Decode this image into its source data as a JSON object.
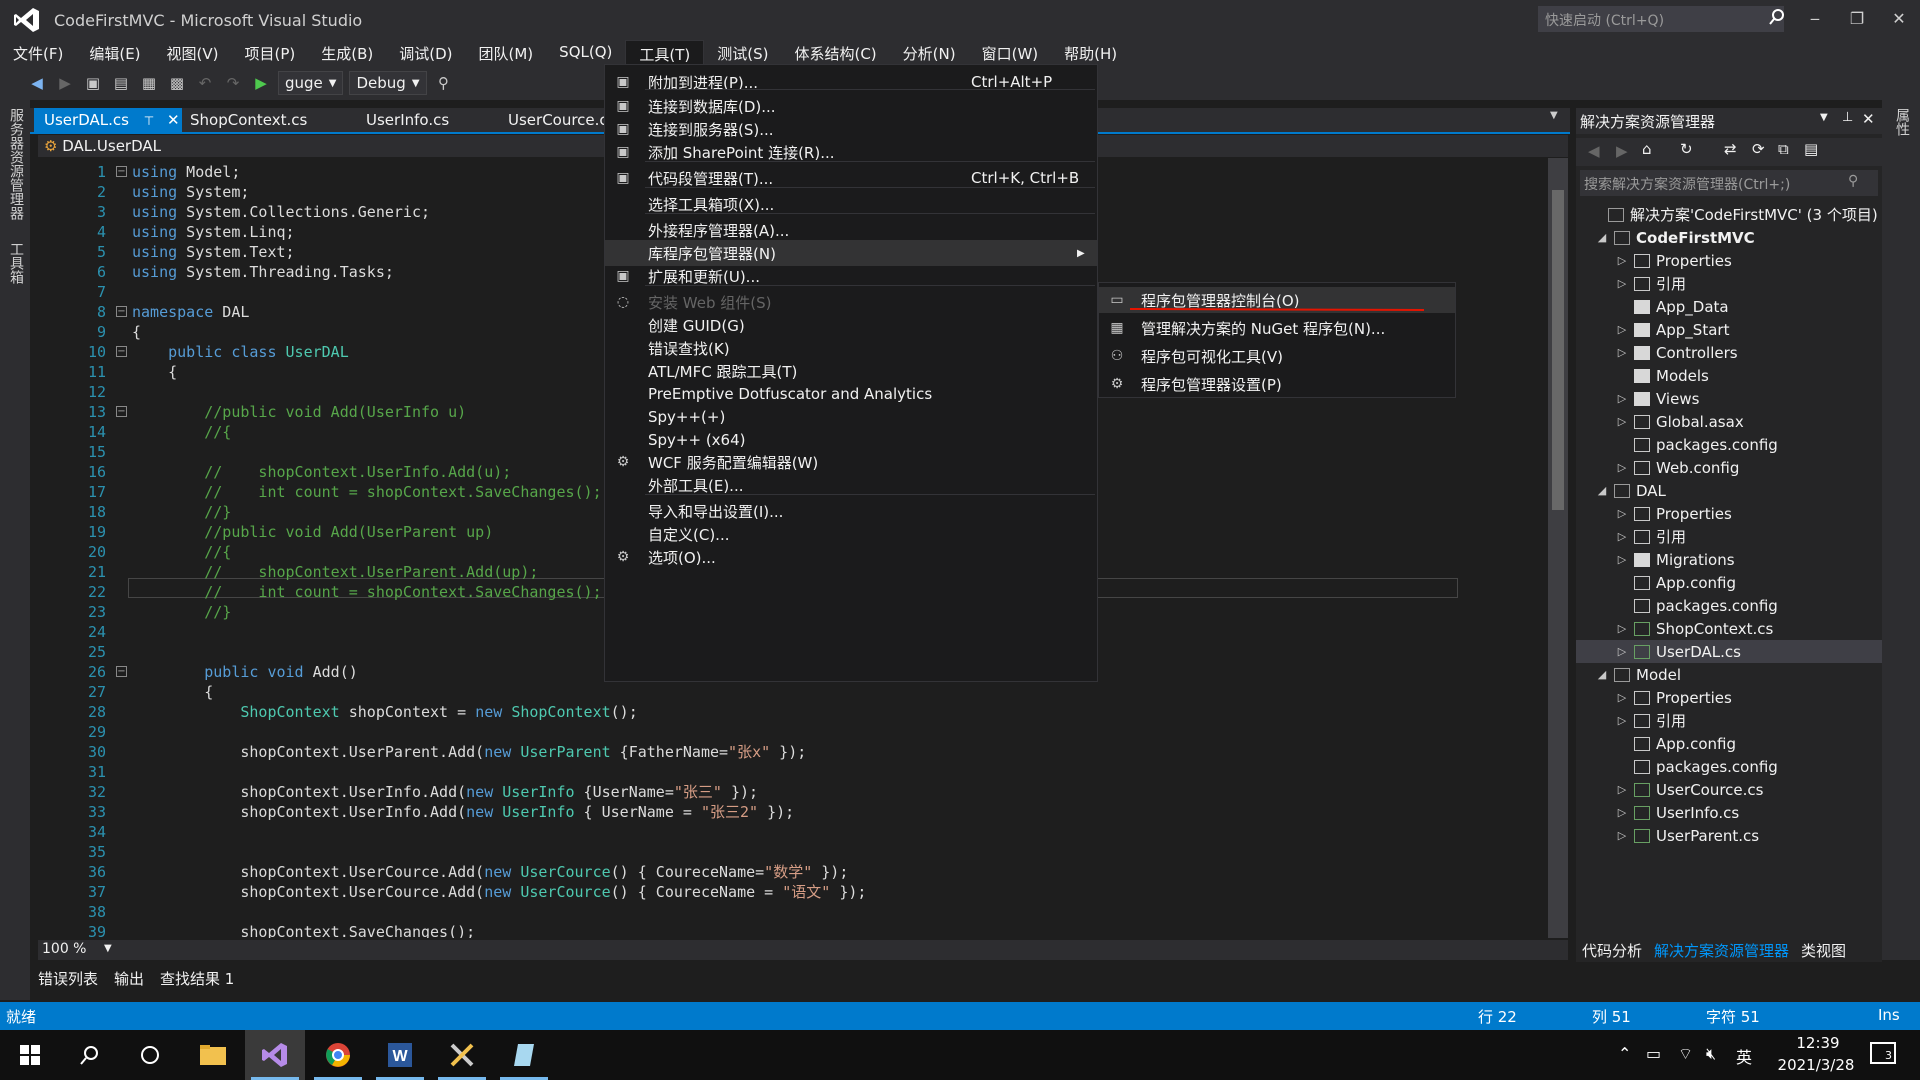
{
  "window": {
    "title": "CodeFirstMVC - Microsoft Visual Studio",
    "quick_launch": "快速启动 (Ctrl+Q)"
  },
  "menubar": [
    "文件(F)",
    "编辑(E)",
    "视图(V)",
    "项目(P)",
    "生成(B)",
    "调试(D)",
    "团队(M)",
    "SQL(Q)",
    "工具(T)",
    "测试(S)",
    "体系结构(C)",
    "分析(N)",
    "窗口(W)",
    "帮助(H)"
  ],
  "toolbar": {
    "start_label": "guge",
    "config": "Debug"
  },
  "left_strip": {
    "server_explorer": "服务器资源管理器",
    "toolbox": "工具箱"
  },
  "tabs": [
    "UserDAL.cs",
    "ShopContext.cs",
    "UserInfo.cs",
    "UserCource.cs"
  ],
  "navbar": {
    "scope": "DAL.UserDAL"
  },
  "code_lines": [
    {
      "n": "1",
      "t": "using Model;"
    },
    {
      "n": "2",
      "t": "using System;"
    },
    {
      "n": "3",
      "t": "using System.Collections.Generic;"
    },
    {
      "n": "4",
      "t": "using System.Linq;"
    },
    {
      "n": "5",
      "t": "using System.Text;"
    },
    {
      "n": "6",
      "t": "using System.Threading.Tasks;"
    },
    {
      "n": "7",
      "t": ""
    },
    {
      "n": "8",
      "t": "namespace DAL"
    },
    {
      "n": "9",
      "t": "{"
    },
    {
      "n": "10",
      "t": "    public class UserDAL"
    },
    {
      "n": "11",
      "t": "    {"
    },
    {
      "n": "12",
      "t": ""
    },
    {
      "n": "13",
      "t": "        //public void Add(UserInfo u)"
    },
    {
      "n": "14",
      "t": "        //{"
    },
    {
      "n": "15",
      "t": ""
    },
    {
      "n": "16",
      "t": "        //    shopContext.UserInfo.Add(u);"
    },
    {
      "n": "17",
      "t": "        //    int count = shopContext.SaveChanges();"
    },
    {
      "n": "18",
      "t": "        //}"
    },
    {
      "n": "19",
      "t": "        //public void Add(UserParent up)"
    },
    {
      "n": "20",
      "t": "        //{"
    },
    {
      "n": "21",
      "t": "        //    shopContext.UserParent.Add(up);"
    },
    {
      "n": "22",
      "t": "        //    int count = shopContext.SaveChanges();"
    },
    {
      "n": "23",
      "t": "        //}"
    },
    {
      "n": "24",
      "t": ""
    },
    {
      "n": "25",
      "t": ""
    },
    {
      "n": "26",
      "t": "        public void Add()"
    },
    {
      "n": "27",
      "t": "        {"
    },
    {
      "n": "28",
      "t": "            ShopContext shopContext = new ShopContext();"
    },
    {
      "n": "29",
      "t": ""
    },
    {
      "n": "30",
      "t": "            shopContext.UserParent.Add(new UserParent {FatherName=\"张x\" });"
    },
    {
      "n": "31",
      "t": ""
    },
    {
      "n": "32",
      "t": "            shopContext.UserInfo.Add(new UserInfo {UserName=\"张三\" });"
    },
    {
      "n": "33",
      "t": "            shopContext.UserInfo.Add(new UserInfo { UserName = \"张三2\" });"
    },
    {
      "n": "34",
      "t": ""
    },
    {
      "n": "35",
      "t": ""
    },
    {
      "n": "36",
      "t": "            shopContext.UserCource.Add(new UserCource() { CoureceName=\"数学\" });"
    },
    {
      "n": "37",
      "t": "            shopContext.UserCource.Add(new UserCource() { CoureceName = \"语文\" });"
    },
    {
      "n": "38",
      "t": ""
    },
    {
      "n": "39",
      "t": "            shopContext.SaveChanges();"
    }
  ],
  "zoom": "100 %",
  "bottom_tabs": [
    "错误列表",
    "输出",
    "查找结果 1"
  ],
  "tools_menu": [
    {
      "label": "附加到进程(P)...",
      "shortcut": "Ctrl+Alt+P",
      "icon": "attach-icon"
    },
    {
      "label": "连接到数据库(D)...",
      "shortcut": "",
      "icon": "database-icon"
    },
    {
      "label": "连接到服务器(S)...",
      "shortcut": "",
      "icon": "server-icon"
    },
    {
      "label": "添加 SharePoint 连接(R)...",
      "shortcut": "",
      "icon": "sharepoint-icon"
    },
    {
      "label": "代码段管理器(T)...",
      "shortcut": "Ctrl+K, Ctrl+B",
      "icon": "snippet-icon"
    },
    {
      "label": "选择工具箱项(X)...",
      "shortcut": "",
      "icon": ""
    },
    {
      "label": "外接程序管理器(A)...",
      "shortcut": "",
      "icon": ""
    },
    {
      "label": "库程序包管理器(N)",
      "shortcut": "",
      "icon": ""
    },
    {
      "label": "扩展和更新(U)...",
      "shortcut": "",
      "icon": "extensions-icon"
    },
    {
      "label": "安装 Web 组件(S)",
      "shortcut": "",
      "icon": "web-icon"
    },
    {
      "label": "创建 GUID(G)",
      "shortcut": "",
      "icon": ""
    },
    {
      "label": "错误查找(K)",
      "shortcut": "",
      "icon": ""
    },
    {
      "label": "ATL/MFC 跟踪工具(T)",
      "shortcut": "",
      "icon": ""
    },
    {
      "label": "PreEmptive Dotfuscator and Analytics",
      "shortcut": "",
      "icon": ""
    },
    {
      "label": "Spy++(+)",
      "shortcut": "",
      "icon": ""
    },
    {
      "label": "Spy++ (x64)",
      "shortcut": "",
      "icon": ""
    },
    {
      "label": "WCF 服务配置编辑器(W)",
      "shortcut": "",
      "icon": "wcf-icon"
    },
    {
      "label": "外部工具(E)...",
      "shortcut": "",
      "icon": ""
    },
    {
      "label": "导入和导出设置(I)...",
      "shortcut": "",
      "icon": ""
    },
    {
      "label": "自定义(C)...",
      "shortcut": "",
      "icon": ""
    },
    {
      "label": "选项(O)...",
      "shortcut": "",
      "icon": "gear-icon"
    }
  ],
  "package_submenu": [
    {
      "label": "程序包管理器控制台(O)",
      "icon": "console-icon"
    },
    {
      "label": "管理解决方案的 NuGet 程序包(N)...",
      "icon": "nuget-icon"
    },
    {
      "label": "程序包可视化工具(V)",
      "icon": "visualizer-icon"
    },
    {
      "label": "程序包管理器设置(P)",
      "icon": "gear-icon"
    }
  ],
  "solution_explorer": {
    "title": "解决方案资源管理器",
    "search_placeholder": "搜索解决方案资源管理器(Ctrl+;)",
    "nodes": [
      {
        "label": "解决方案'CodeFirstMVC' (3 个项目)",
        "level": 0,
        "arrow": "",
        "bold": false
      },
      {
        "label": "CodeFirstMVC",
        "level": 1,
        "arrow": "◢",
        "bold": true
      },
      {
        "label": "Properties",
        "level": 2,
        "arrow": "▷",
        "bold": false
      },
      {
        "label": "引用",
        "level": 2,
        "arrow": "▷",
        "bold": false
      },
      {
        "label": "App_Data",
        "level": 2,
        "arrow": "",
        "bold": false
      },
      {
        "label": "App_Start",
        "level": 2,
        "arrow": "▷",
        "bold": false
      },
      {
        "label": "Controllers",
        "level": 2,
        "arrow": "▷",
        "bold": false
      },
      {
        "label": "Models",
        "level": 2,
        "arrow": "",
        "bold": false
      },
      {
        "label": "Views",
        "level": 2,
        "arrow": "▷",
        "bold": false
      },
      {
        "label": "Global.asax",
        "level": 2,
        "arrow": "▷",
        "bold": false
      },
      {
        "label": "packages.config",
        "level": 2,
        "arrow": "",
        "bold": false
      },
      {
        "label": "Web.config",
        "level": 2,
        "arrow": "▷",
        "bold": false
      },
      {
        "label": "DAL",
        "level": 1,
        "arrow": "◢",
        "bold": false
      },
      {
        "label": "Properties",
        "level": 2,
        "arrow": "▷",
        "bold": false
      },
      {
        "label": "引用",
        "level": 2,
        "arrow": "▷",
        "bold": false
      },
      {
        "label": "Migrations",
        "level": 2,
        "arrow": "▷",
        "bold": false
      },
      {
        "label": "App.config",
        "level": 2,
        "arrow": "",
        "bold": false
      },
      {
        "label": "packages.config",
        "level": 2,
        "arrow": "",
        "bold": false
      },
      {
        "label": "ShopContext.cs",
        "level": 2,
        "arrow": "▷",
        "bold": false
      },
      {
        "label": "UserDAL.cs",
        "level": 2,
        "arrow": "▷",
        "bold": false
      },
      {
        "label": "Model",
        "level": 1,
        "arrow": "◢",
        "bold": false
      },
      {
        "label": "Properties",
        "level": 2,
        "arrow": "▷",
        "bold": false
      },
      {
        "label": "引用",
        "level": 2,
        "arrow": "▷",
        "bold": false
      },
      {
        "label": "App.config",
        "level": 2,
        "arrow": "",
        "bold": false
      },
      {
        "label": "packages.config",
        "level": 2,
        "arrow": "",
        "bold": false
      },
      {
        "label": "UserCource.cs",
        "level": 2,
        "arrow": "▷",
        "bold": false
      },
      {
        "label": "UserInfo.cs",
        "level": 2,
        "arrow": "▷",
        "bold": false
      },
      {
        "label": "UserParent.cs",
        "level": 2,
        "arrow": "▷",
        "bold": false
      }
    ],
    "bottom_tabs": [
      "代码分析",
      "解决方案资源管理器",
      "类视图"
    ]
  },
  "right_strip": {
    "properties": "属性"
  },
  "statusbar": {
    "ready": "就绪",
    "row": "行 22",
    "col": "列 51",
    "char": "字符 51",
    "mode": "Ins"
  },
  "taskbar": {
    "time": "12:39",
    "date": "2021/3/28",
    "lang": "英",
    "notif": "3"
  },
  "colors": {
    "accent": "#007acc",
    "bg": "#1e1e1e",
    "menu_bg": "#1b1b1c",
    "annotation_red": "#e51400"
  }
}
